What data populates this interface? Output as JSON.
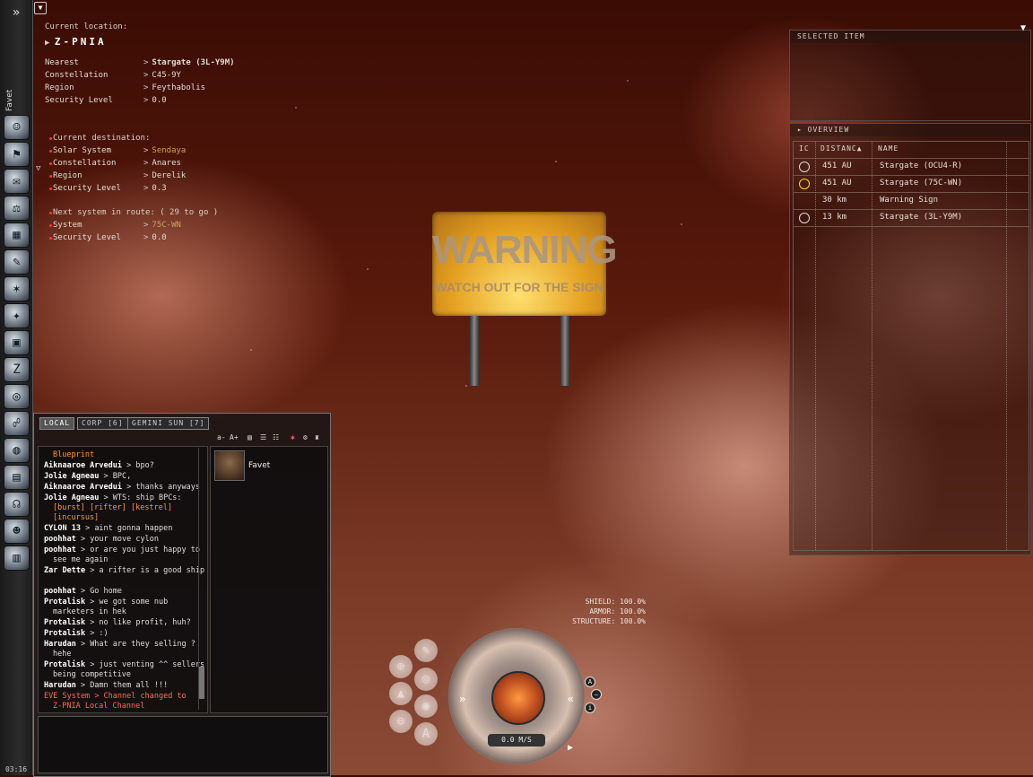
{
  "pilot": {
    "name": "Favet",
    "clock": "03:16"
  },
  "location": {
    "current_label": "Current location:",
    "system": "Z-PNIA",
    "rows": [
      {
        "k": "Nearest",
        "v": "Stargate (3L-Y9M)"
      },
      {
        "k": "Constellation",
        "v": "C45-9Y"
      },
      {
        "k": "Region",
        "v": "Feythabolis"
      },
      {
        "k": "Security Level",
        "v": "0.0"
      }
    ]
  },
  "destination": {
    "label": "Current destination:",
    "rows": [
      {
        "k": "Solar System",
        "v": "Sendaya"
      },
      {
        "k": "Constellation",
        "v": "Anares"
      },
      {
        "k": "Region",
        "v": "Derelik"
      },
      {
        "k": "Security Level",
        "v": "0.3"
      }
    ],
    "next_label": "Next system in route: ( 29 to go )",
    "next_rows": [
      {
        "k": "System",
        "v": "75C-WN"
      },
      {
        "k": "Security Level",
        "v": "0.0"
      }
    ]
  },
  "sign": {
    "headline": "WARNING",
    "subline": "WATCH OUT FOR THE SIGN"
  },
  "selected_item": {
    "title": "SELECTED ITEM"
  },
  "overview": {
    "title": "OVERVIEW",
    "columns": [
      "IC",
      "DISTANC",
      "NAME"
    ],
    "rows": [
      {
        "distance": "451 AU",
        "name": "Stargate (OCU4-R)",
        "icon": "stargate-icon"
      },
      {
        "distance": "451 AU",
        "name": "Stargate (75C-WN)",
        "icon": "stargate-destination-icon"
      },
      {
        "distance": "30 km",
        "name": "Warning Sign",
        "icon": ""
      },
      {
        "distance": "13 km",
        "name": "Stargate (3L-Y9M)",
        "icon": "stargate-icon"
      }
    ]
  },
  "chat": {
    "tabs": [
      "LOCAL",
      "CORP [6]",
      "GEMINI SUN [7]"
    ],
    "font_controls": [
      "a-",
      "A+"
    ],
    "messages": [
      {
        "who": "",
        "text": "Blueprint",
        "kind": "hl",
        "indent": true
      },
      {
        "who": "Aiknaaroe Arvedui",
        "text": "> bpo?"
      },
      {
        "who": "Jolie Agneau",
        "text": "> BPC,"
      },
      {
        "who": "Aiknaaroe Arvedui",
        "text": "> thanks anyways"
      },
      {
        "who": "Jolie Agneau",
        "text": "> WTS: ship BPCs:"
      },
      {
        "who": "",
        "text": "[burst] [rifter] [kestrel]",
        "kind": "hl",
        "indent": true
      },
      {
        "who": "",
        "text": "[incursus]",
        "kind": "hl",
        "indent": true
      },
      {
        "who": "CYLON 13",
        "text": "> aint gonna happen"
      },
      {
        "who": "poohhat",
        "text": "> your move cylon"
      },
      {
        "who": "poohhat",
        "text": "> or are you just happy to"
      },
      {
        "who": "",
        "text": "see me again",
        "indent": true
      },
      {
        "who": "Zar Dette",
        "text": "> a rifter is a good ship"
      },
      {
        "who": "",
        "text": "",
        "indent": true
      },
      {
        "who": "poohhat",
        "text": "> Go home"
      },
      {
        "who": "Protalisk",
        "text": "> we got some nub"
      },
      {
        "who": "",
        "text": "marketers in hek",
        "indent": true
      },
      {
        "who": "Protalisk",
        "text": "> no like profit, huh?"
      },
      {
        "who": "Protalisk",
        "text": "> :)"
      },
      {
        "who": "Harudan",
        "text": "> What are they selling ?"
      },
      {
        "who": "",
        "text": "hehe",
        "indent": true
      },
      {
        "who": "Protalisk",
        "text": "> just venting ^^ sellers"
      },
      {
        "who": "",
        "text": "being competitive",
        "indent": true
      },
      {
        "who": "Harudan",
        "text": "> Damn them all !!!"
      },
      {
        "who": "EVE System",
        "text": "> Channel changed to",
        "kind": "sys"
      },
      {
        "who": "",
        "text": "Z-PNIA Local Channel",
        "kind": "sys",
        "indent": true
      }
    ],
    "member": "Favet"
  },
  "ship_status": {
    "shield": "SHIELD: 100.0%",
    "armor": "ARMOR: 100.0%",
    "structure": "STRUCTURE: 100.0%",
    "speed": "0.0 M/S"
  }
}
